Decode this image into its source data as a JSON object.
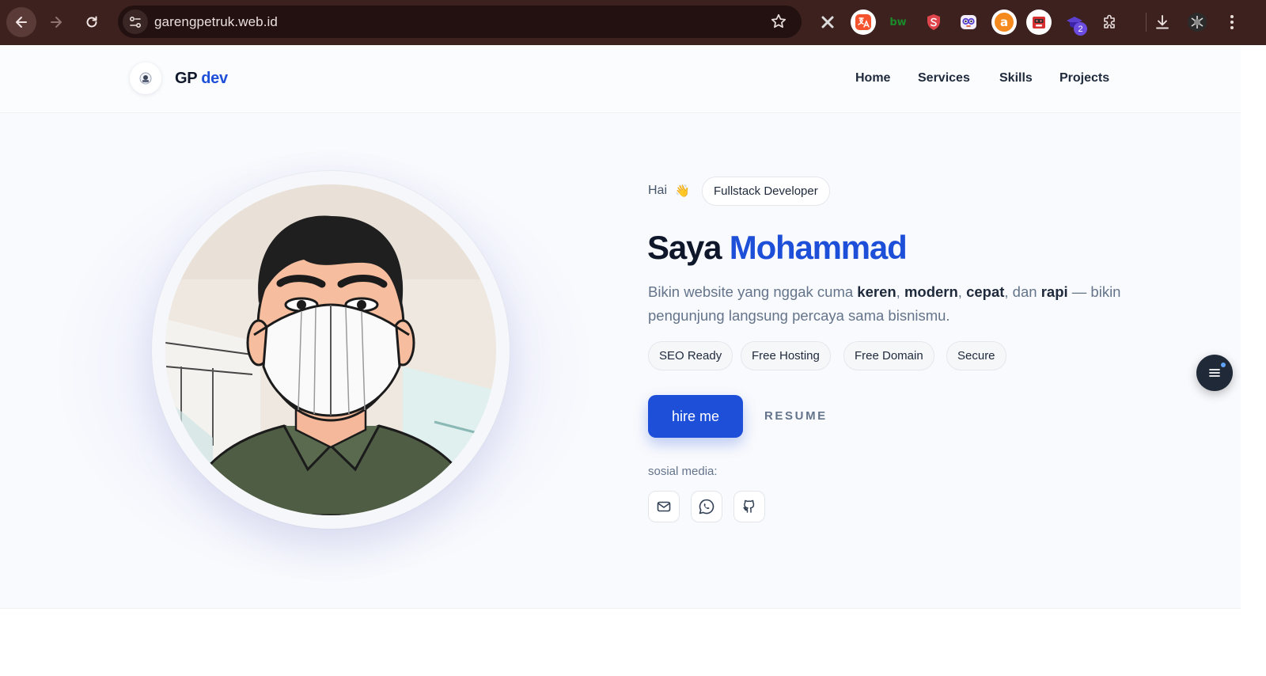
{
  "browser": {
    "url": "garengpetruk.web.id",
    "extension_badge_count": "2",
    "extensions": [
      {
        "icon": "x-extension-icon",
        "color": "#3c3c3c"
      },
      {
        "icon": "translate-extension-icon",
        "color": "#f5532d"
      },
      {
        "icon": "bw-extension-icon",
        "color": "#1b8a2a"
      },
      {
        "icon": "shield-extension-icon",
        "color": "#e0454b"
      },
      {
        "icon": "owl-extension-icon",
        "color": "#7b5bd6"
      },
      {
        "icon": "a-extension-icon",
        "color": "#f58a1f"
      },
      {
        "icon": "robot-extension-icon",
        "color": "#d63031"
      },
      {
        "icon": "hat-extension-icon",
        "color": "#5b3fd1"
      }
    ]
  },
  "header": {
    "brand_main": "GP",
    "brand_accent": "dev",
    "nav": [
      "Home",
      "Services",
      "Skills",
      "Projects"
    ]
  },
  "hero": {
    "greeting": "Hai",
    "wave": "👋",
    "role": "Fullstack Developer",
    "headline_prefix": "Saya",
    "headline_name": "Mohammad",
    "desc": {
      "p1": "Bikin website yang nggak cuma ",
      "b1": "keren",
      "s1": ", ",
      "b2": "modern",
      "s2": ", ",
      "b3": "cepat",
      "s3": ", dan ",
      "b4": "rapi",
      "p2": " — bikin pengunjung langsung percaya sama bisnismu."
    },
    "features": [
      "SEO Ready",
      "Free Hosting",
      "Free Domain",
      "Secure"
    ],
    "hire_label": "hire me",
    "resume_label": "RESUME",
    "social_label": "sosial media:"
  },
  "colors": {
    "accent": "#1d4fd8",
    "chrome": "#3c211e"
  }
}
